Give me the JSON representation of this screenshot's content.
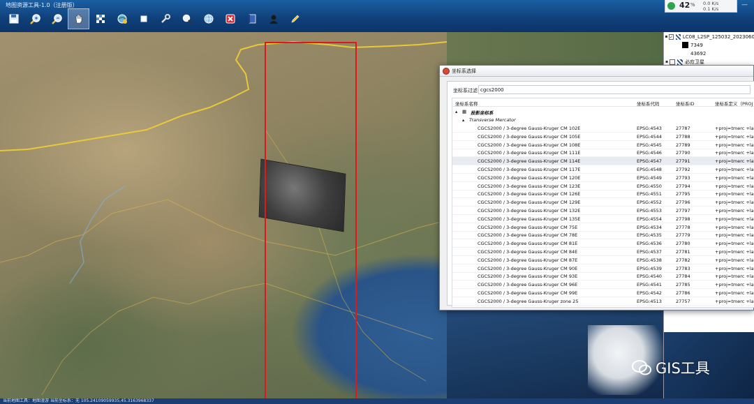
{
  "app": {
    "title": "地图资源工具-1.0（注册版）"
  },
  "toolbar": {
    "buttons": [
      {
        "name": "save",
        "icon": "save-icon"
      },
      {
        "name": "zoom-in",
        "icon": "zoom-in-icon"
      },
      {
        "name": "zoom-out",
        "icon": "zoom-out-icon"
      },
      {
        "name": "pan",
        "icon": "hand-pan-icon",
        "active": true
      },
      {
        "name": "grid",
        "icon": "checkerboard-icon"
      },
      {
        "name": "globe-settings",
        "icon": "globe-gear-icon"
      },
      {
        "name": "select",
        "icon": "square-select-icon"
      },
      {
        "name": "tools",
        "icon": "wrench-icon"
      },
      {
        "name": "search",
        "icon": "magnifier-icon"
      },
      {
        "name": "layers",
        "icon": "globe-icon"
      },
      {
        "name": "close-layer",
        "icon": "red-x-icon"
      },
      {
        "name": "help",
        "icon": "book-icon"
      },
      {
        "name": "user",
        "icon": "user-icon"
      },
      {
        "name": "edit",
        "icon": "pencil-icon"
      }
    ]
  },
  "tray": {
    "battery_pct": "42",
    "pct_sign": "%",
    "net_up": "0.0 K/s",
    "net_down": "0.1 K/s"
  },
  "layer_panel": {
    "items": [
      {
        "label": "LC08_L2SP_125032_2023060",
        "checked": true
      },
      {
        "label": "7349"
      },
      {
        "label": "43692"
      },
      {
        "label": "必应卫星",
        "checked": false
      }
    ]
  },
  "watermark": {
    "text": "GIS工具"
  },
  "statusbar": {
    "text": "当前地图工具：地图漫游  当前坐标系：无 105.24109059935,45.3163968337"
  },
  "dialog": {
    "title": "坐标系选择",
    "filter_label": "坐标系过滤",
    "filter_value": "cgcs2000",
    "columns": [
      "坐标系名称",
      "坐标系代码",
      "坐标系ID",
      "坐标系定义（PROJ"
    ],
    "group_projected": "投影坐标系",
    "group_tm": "Transverse Mercator",
    "rows": [
      [
        "CGCS2000 / 3-degree Gauss-Kruger CM 102E",
        "EPSG:4543",
        "27787",
        "+proj=tmerc +lat"
      ],
      [
        "CGCS2000 / 3-degree Gauss-Kruger CM 105E",
        "EPSG:4544",
        "27788",
        "+proj=tmerc +lat"
      ],
      [
        "CGCS2000 / 3-degree Gauss-Kruger CM 108E",
        "EPSG:4545",
        "27789",
        "+proj=tmerc +lat"
      ],
      [
        "CGCS2000 / 3-degree Gauss-Kruger CM 111E",
        "EPSG:4546",
        "27790",
        "+proj=tmerc +lat"
      ],
      [
        "CGCS2000 / 3-degree Gauss-Kruger CM 114E",
        "EPSG:4547",
        "27791",
        "+proj=tmerc +lat"
      ],
      [
        "CGCS2000 / 3-degree Gauss-Kruger CM 117E",
        "EPSG:4548",
        "27792",
        "+proj=tmerc +lat"
      ],
      [
        "CGCS2000 / 3-degree Gauss-Kruger CM 120E",
        "EPSG:4549",
        "27793",
        "+proj=tmerc +lat"
      ],
      [
        "CGCS2000 / 3-degree Gauss-Kruger CM 123E",
        "EPSG:4550",
        "27794",
        "+proj=tmerc +lat"
      ],
      [
        "CGCS2000 / 3-degree Gauss-Kruger CM 126E",
        "EPSG:4551",
        "27795",
        "+proj=tmerc +lat"
      ],
      [
        "CGCS2000 / 3-degree Gauss-Kruger CM 129E",
        "EPSG:4552",
        "27796",
        "+proj=tmerc +lat"
      ],
      [
        "CGCS2000 / 3-degree Gauss-Kruger CM 132E",
        "EPSG:4553",
        "27797",
        "+proj=tmerc +lat"
      ],
      [
        "CGCS2000 / 3-degree Gauss-Kruger CM 135E",
        "EPSG:4554",
        "27798",
        "+proj=tmerc +lat"
      ],
      [
        "CGCS2000 / 3-degree Gauss-Kruger CM 75E",
        "EPSG:4534",
        "27778",
        "+proj=tmerc +lat"
      ],
      [
        "CGCS2000 / 3-degree Gauss-Kruger CM 78E",
        "EPSG:4535",
        "27779",
        "+proj=tmerc +lat"
      ],
      [
        "CGCS2000 / 3-degree Gauss-Kruger CM 81E",
        "EPSG:4536",
        "27780",
        "+proj=tmerc +lat"
      ],
      [
        "CGCS2000 / 3-degree Gauss-Kruger CM 84E",
        "EPSG:4537",
        "27781",
        "+proj=tmerc +lat"
      ],
      [
        "CGCS2000 / 3-degree Gauss-Kruger CM 87E",
        "EPSG:4538",
        "27782",
        "+proj=tmerc +lat"
      ],
      [
        "CGCS2000 / 3-degree Gauss-Kruger CM 90E",
        "EPSG:4539",
        "27783",
        "+proj=tmerc +lat"
      ],
      [
        "CGCS2000 / 3-degree Gauss-Kruger CM 93E",
        "EPSG:4540",
        "27784",
        "+proj=tmerc +lat"
      ],
      [
        "CGCS2000 / 3-degree Gauss-Kruger CM 96E",
        "EPSG:4541",
        "27785",
        "+proj=tmerc +lat"
      ],
      [
        "CGCS2000 / 3-degree Gauss-Kruger CM 99E",
        "EPSG:4542",
        "27786",
        "+proj=tmerc +lat"
      ],
      [
        "CGCS2000 / 3-degree Gauss-Kruger zone 25",
        "EPSG:4513",
        "27757",
        "+proj=tmerc +lat"
      ]
    ],
    "selected_index": 4
  }
}
